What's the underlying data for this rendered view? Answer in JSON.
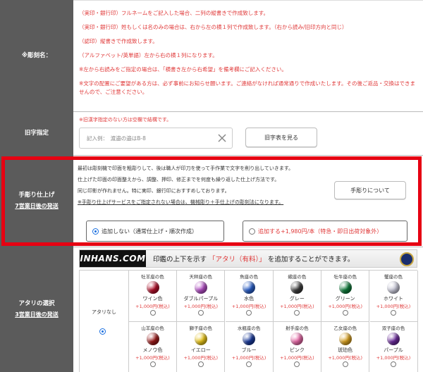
{
  "engrave": {
    "label": "※彫刻名：",
    "lines": [
      "（実印・銀行印）フルネームをご記入した場合、二列の縦書きで作成致します。",
      "（実印・銀行印）姓もしくは名のみの場合は、右から左の横１列で作成致します。（右から読み/旧印方向と同じ）",
      "（認印）縦書きで作成致します。",
      "（アルファベット/英単語）左から右の横１列になります。",
      "※左から右読みをご指定の場合は、「横書き左から右希望」を備考欄にご記入ください。",
      "※文字の配置にご要望がある方は、必ず事前にお知らせ願います。ご連絡がなければ通常通りで作成いたします。その後ご返品・交換はできませんので、ご注意ください。"
    ]
  },
  "kyuji": {
    "label": "旧字指定",
    "note": "※旧漢字指定のない方は空欄で結構です。",
    "placeholder": "記入例：　渡邉の邉はB-8",
    "button": "旧字表を見る"
  },
  "hand": {
    "label": "手彫り仕上げ",
    "sublabel": "7営業日後の発送",
    "desc": [
      "最初は彫刻機で印面を粗彫りして、後は職人が印刀を使って手作業で文字を削り出していきます。",
      "仕上げた印面の印面整えから、調整、押印、修正までを何度も繰り返した仕上げ方法です。",
      "同じ印影が作れません。特に実印、銀行印におすすめしております。",
      "※手彫り仕上げサービスをご指定されない場合は、機械彫り＋手仕上げの彫刻法になります。"
    ],
    "about_button": "手彫りについて",
    "option_off": "追加しない（通常仕上げ・順次作成）",
    "option_on": "追加する+1,980円/本（特急・即日出荷対象外）"
  },
  "atari": {
    "label": "アタリの選択",
    "sublabel": "3営業日後の発送",
    "logo": "INHANS.COM",
    "banner_pre": "印鑑の上下を示す",
    "banner_hl": "「アタリ（有料）」",
    "banner_post": "を追加することができます。",
    "none_label": "アタリなし",
    "stones": [
      {
        "sign": "牡羊座の色",
        "name": "ワイン色",
        "price": "+1,000円(税込)",
        "color": "#b0102a"
      },
      {
        "sign": "天秤座の色",
        "name": "ダブルパープル",
        "price": "+1,000円(税込)",
        "color": "#b24fc4"
      },
      {
        "sign": "魚座の色",
        "name": "水色",
        "price": "+1,000円(税込)",
        "color": "#2a5fc8"
      },
      {
        "sign": "蠍座の色",
        "name": "グレー",
        "price": "+1,000円(税込)",
        "color": "#3a3a3a"
      },
      {
        "sign": "牡牛座の色",
        "name": "グリーン",
        "price": "+1,000円(税込)",
        "color": "#0e7a3a"
      },
      {
        "sign": "蟹座の色",
        "name": "ホワイト",
        "price": "+1,000円(税込)",
        "color": "#c8c8d8"
      },
      {
        "sign": "山羊座の色",
        "name": "メノウ色",
        "price": "+1,000円(税込)",
        "color": "#9a1a1a"
      },
      {
        "sign": "獅子座の色",
        "name": "イエロー",
        "price": "+1,000円(税込)",
        "color": "#e8c41a"
      },
      {
        "sign": "水瓶座の色",
        "name": "ブルー",
        "price": "+1,000円(税込)",
        "color": "#1a3a9a"
      },
      {
        "sign": "射手座の色",
        "name": "ピンク",
        "price": "+1,000円(税込)",
        "color": "#e86aa8"
      },
      {
        "sign": "乙女座の色",
        "name": "琥珀色",
        "price": "+1,000円(税込)",
        "color": "#d8a020"
      },
      {
        "sign": "双子座の色",
        "name": "パープル",
        "price": "+1,000円(税込)",
        "color": "#6a2a9a"
      }
    ]
  }
}
